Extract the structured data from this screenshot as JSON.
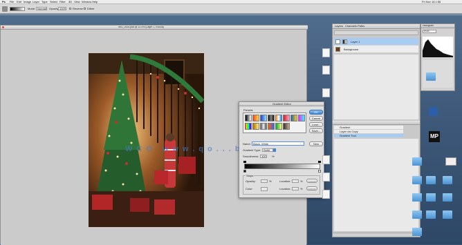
{
  "menubar": {
    "app_name": "Ps",
    "items": [
      "File",
      "Edit",
      "Image",
      "Layer",
      "Type",
      "Select",
      "Filter",
      "3D",
      "View",
      "Window",
      "Help"
    ],
    "clock": "Fri Nov 18  1:56"
  },
  "options_bar": {
    "mode_label": "Mode:",
    "mode_value": "Normal",
    "opacity_label": "Opacity:",
    "opacity_value": "100%",
    "reverse_label": "Reverse",
    "dither_label": "Dither",
    "transparency_label": "Transparency"
  },
  "document": {
    "title": "IMG_0000.psd @ 12.5% (Layer 1, RGB/8)"
  },
  "watermark": "WCO  www.qo...b.com",
  "layers_panel": {
    "tabs": [
      "Layers",
      "Channels",
      "Paths"
    ],
    "rows": [
      {
        "name": "Layer 1",
        "selected": true
      },
      {
        "name": "Background",
        "selected": false
      }
    ]
  },
  "history_panel": {
    "rows": [
      "Gradient",
      "Layer via Copy",
      "Gradient Tool"
    ]
  },
  "histogram_panel": {
    "title": "Histogram",
    "channel": "RGB"
  },
  "gradient_editor": {
    "title": "Gradient Editor",
    "presets_label": "Presets",
    "ok_label": "OK",
    "cancel_label": "Cancel",
    "load_label": "Load...",
    "save_label": "Save...",
    "name_label": "Name:",
    "name_value": "Black, White",
    "new_label": "New",
    "type_label": "Gradient Type:",
    "type_value": "Solid",
    "smoothness_label": "Smoothness:",
    "smoothness_value": "100",
    "smoothness_unit": "%",
    "stops_label": "Stops",
    "opacity_label": "Opacity:",
    "location_label": "Location:",
    "color_label": "Color:",
    "delete_label": "Delete",
    "percent": "%"
  },
  "desktop": {
    "icons": [
      {
        "label": "",
        "kind": "file"
      },
      {
        "label": "",
        "kind": "file"
      },
      {
        "label": "",
        "kind": "file"
      },
      {
        "label": "",
        "kind": "file"
      },
      {
        "label": "",
        "kind": "file"
      },
      {
        "label": "",
        "kind": "file"
      },
      {
        "label": "",
        "kind": "folder"
      },
      {
        "label": "",
        "kind": "folder"
      },
      {
        "label": "",
        "kind": "folder"
      },
      {
        "label": "",
        "kind": "folder"
      },
      {
        "label": "",
        "kind": "folder"
      }
    ],
    "mp_badge": "MP"
  },
  "colors": {
    "accent": "#3e86d8",
    "selected_row": "#a9cdf2",
    "desktop": "#3f5a7a"
  }
}
